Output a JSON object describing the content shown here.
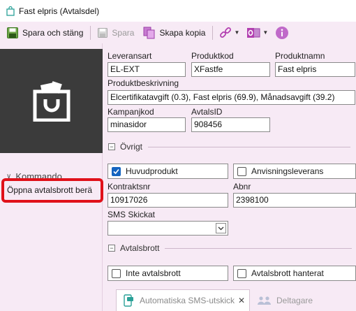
{
  "window": {
    "title": "Fast elpris (Avtalsdel)"
  },
  "toolbar": {
    "save_close_label": "Spara och stäng",
    "save_label": "Spara",
    "copy_label": "Skapa kopia"
  },
  "sidebar": {
    "section_label": "Kommando",
    "command_label": "Öppna avtalsbrott berä"
  },
  "form": {
    "leveransart": {
      "label": "Leveransart",
      "value": "EL-EXT"
    },
    "produktkod": {
      "label": "Produktkod",
      "value": "XFastfe"
    },
    "produktnamn": {
      "label": "Produktnamn",
      "value": "Fast elpris"
    },
    "produktbeskrivning": {
      "label": "Produktbeskrivning",
      "value": "Elcertifikatavgift (0.3), Fast elpris (69.9), Månadsavgift (39.2)"
    },
    "kampanjkod": {
      "label": "Kampanjkod",
      "value": "minasidor"
    },
    "avtalsid": {
      "label": "AvtalsID",
      "value": "908456"
    },
    "section_ovrigt": "Övrigt",
    "huvudprodukt": {
      "label": "Huvudprodukt",
      "checked": true
    },
    "anvisningsleverans": {
      "label": "Anvisningsleverans",
      "checked": false
    },
    "kontraktsnr": {
      "label": "Kontraktsnr",
      "value": "10917026"
    },
    "abnr": {
      "label": "Abnr",
      "value": "2398100"
    },
    "sms_skickat": {
      "label": "SMS Skickat",
      "value": ""
    },
    "section_avtalsbrott": "Avtalsbrott",
    "inte_avtalsbrott": {
      "label": "Inte avtalsbrott",
      "checked": false
    },
    "avtalsbrott_hanterat": {
      "label": "Avtalsbrott hanterat",
      "checked": false
    }
  },
  "tabs": {
    "sms_tab": "Automatiska SMS-utskick",
    "deltagare_tab": "Deltagare"
  },
  "colors": {
    "accent_purple": "#b23fb0",
    "highlight_red": "#e0111a",
    "logo_bg": "#3b3b3b",
    "checkbox_blue": "#1565c0"
  }
}
